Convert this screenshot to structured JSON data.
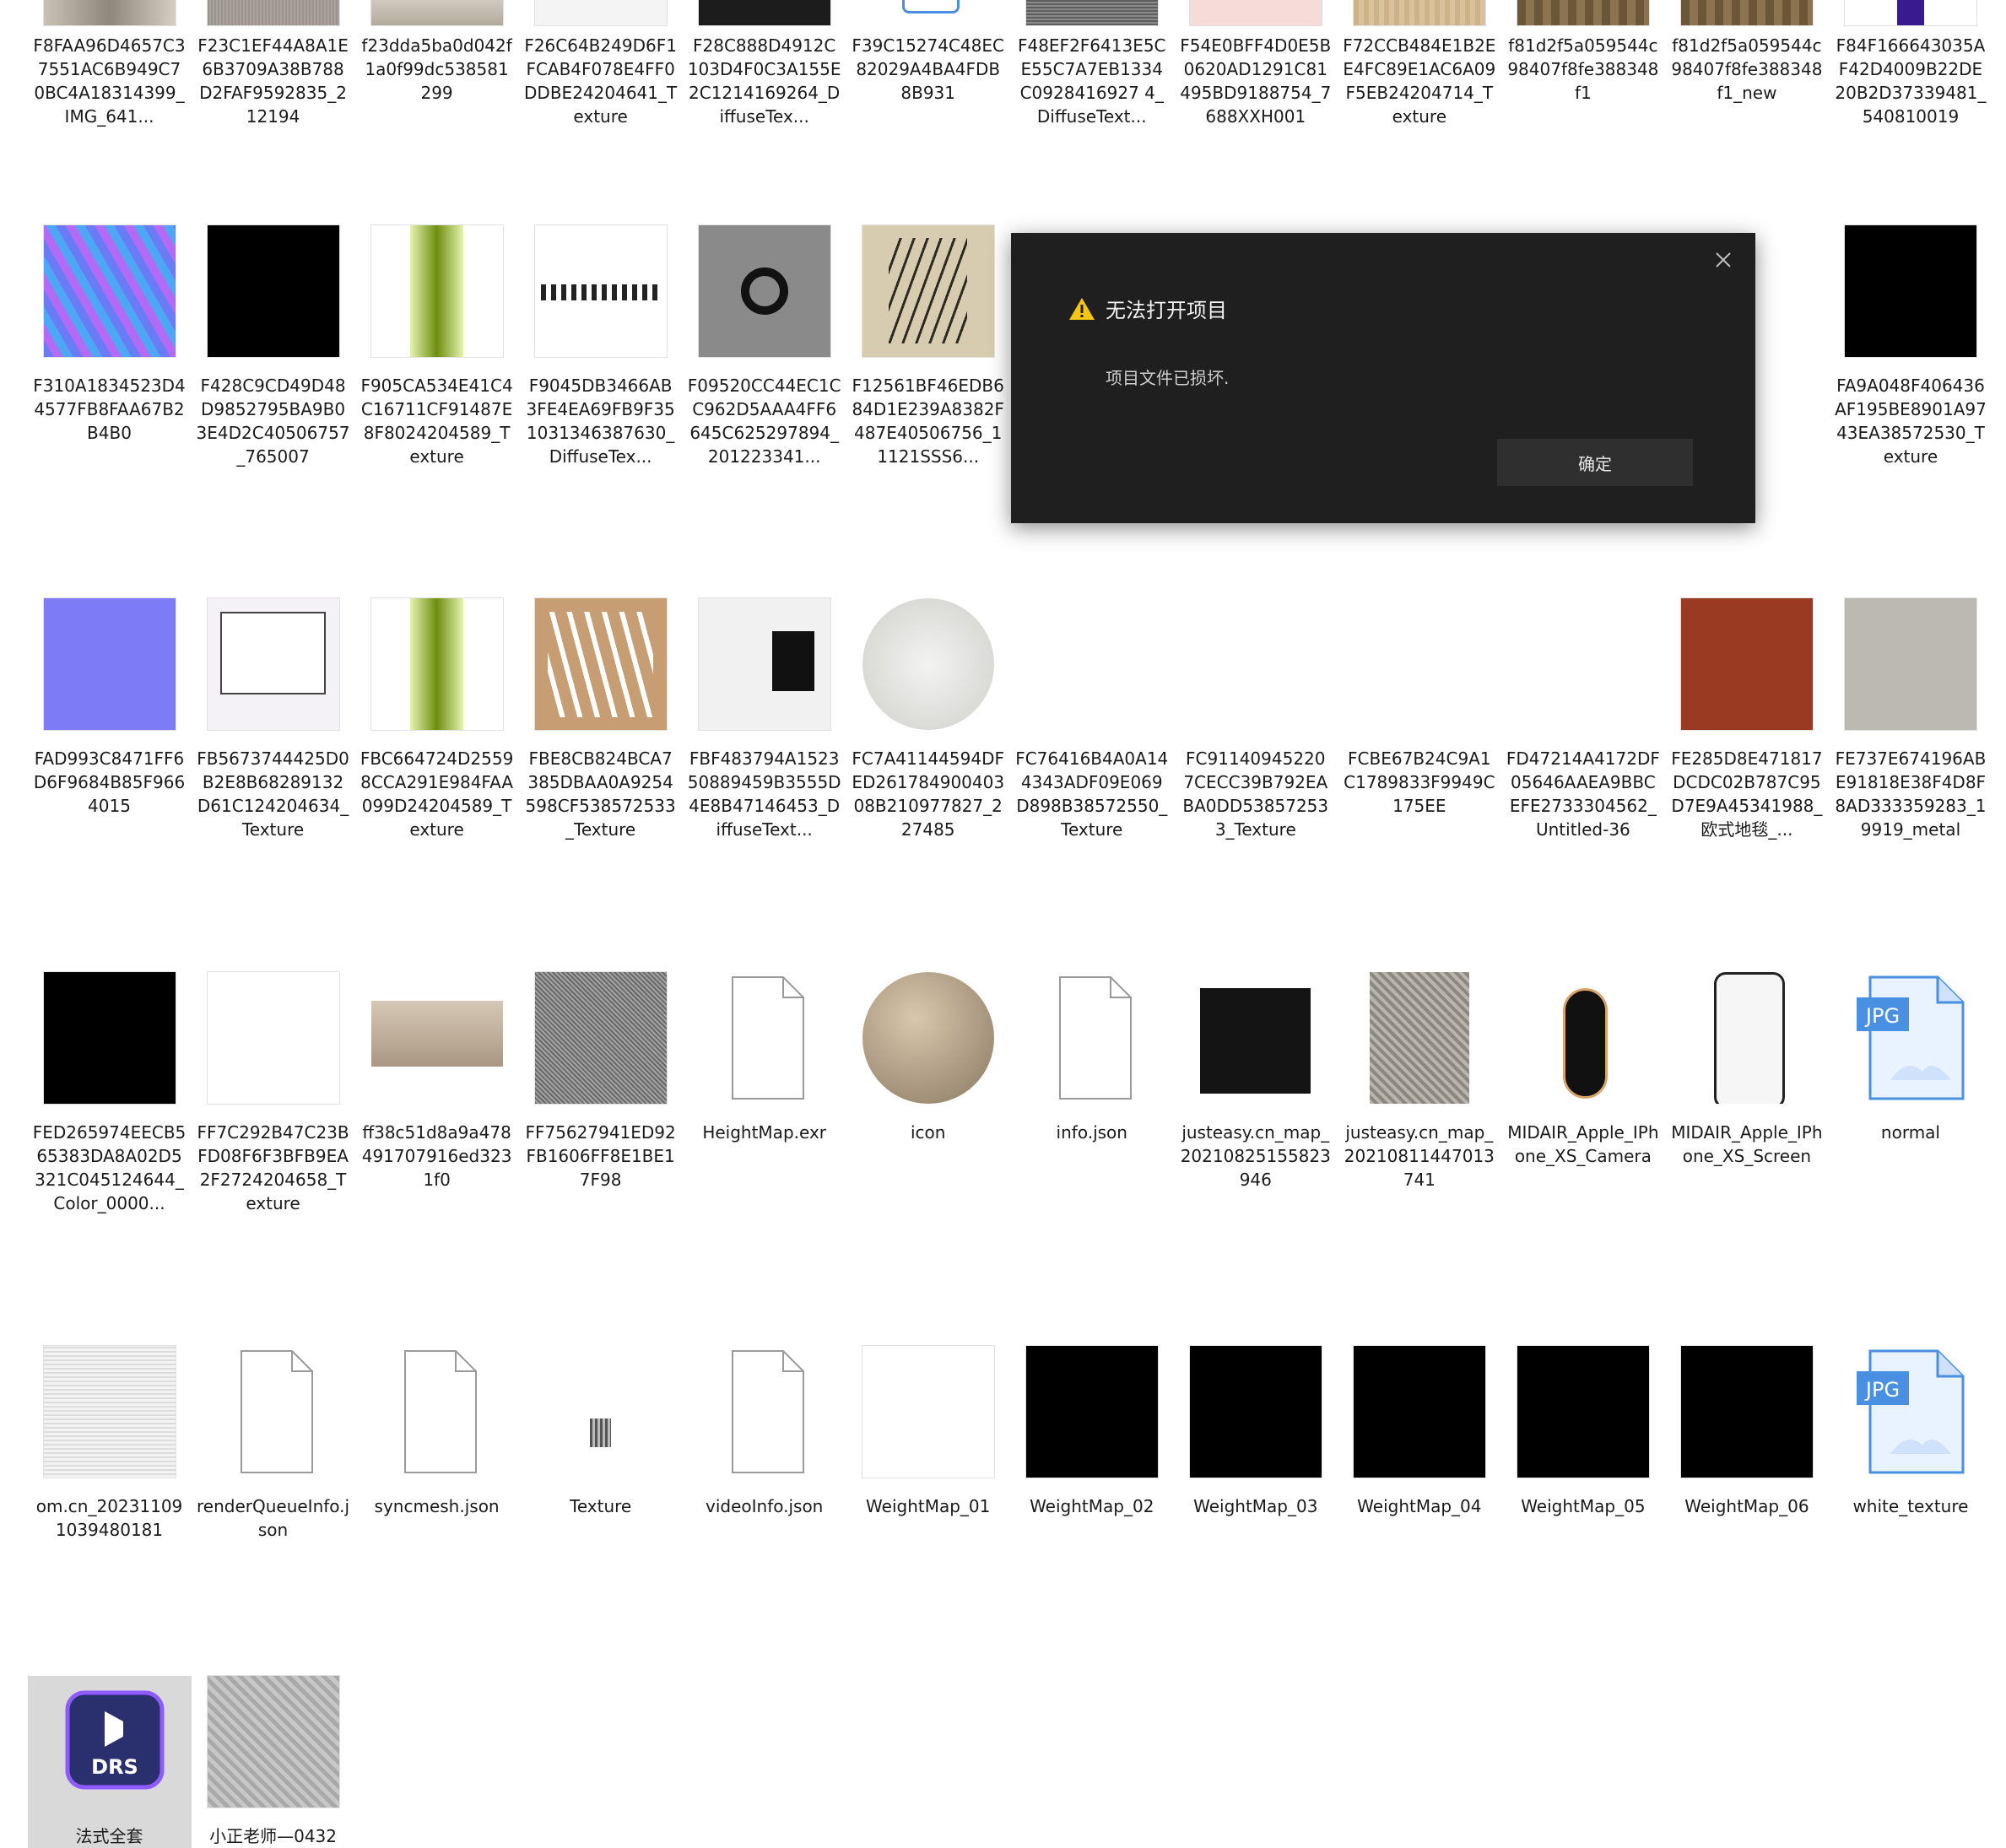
{
  "files": [
    {
      "label": "F8FAA96D4657C37551AC6B949C70BC4A18314399_IMG_641...",
      "thumb": "interior-photo"
    },
    {
      "label": "F23C1EF44A8A1E6B3709A38B788D2FAF9592835_212194",
      "thumb": "gray-fabric"
    },
    {
      "label": "f23dda5ba0d042f1a0f99dc538581299",
      "thumb": "bedroom-photo"
    },
    {
      "label": "F26C64B249D6F1FCAB4F078E4FF0DDBE24204641_Texture",
      "thumb": "white-label"
    },
    {
      "label": "F28C888D4912C103D4F0C3A155E2C1214169264_DiffuseTex...",
      "thumb": "dark-texture"
    },
    {
      "label": "F39C15274C48EC82029A4BA4FDB8B931",
      "thumb": "file-icon-blue"
    },
    {
      "label": "F48EF2F6413E5CE55C7A7EB1334C0928416927 4_DiffuseText...",
      "thumb": "stripe-gray"
    },
    {
      "label": "F54E0BFF4D0E5B0620AD1291C81495BD9188754_7688XXH001",
      "thumb": "pink-flat"
    },
    {
      "label": "F72CCB484E1B2EE4FC89E1AC6A09F5EB24204714_Texture",
      "thumb": "wood-light"
    },
    {
      "label": "f81d2f5a059544c98407f8fe388348f1",
      "thumb": "curtain"
    },
    {
      "label": "f81d2f5a059544c98407f8fe388348f1_new",
      "thumb": "curtain"
    },
    {
      "label": "F84F166643035AF42D4009B22DE20B2D37339481_540810019",
      "thumb": "screen-purple"
    },
    {
      "label": "F310A1834523D44577FB8FAA67B2B4B0",
      "thumb": "wave-blue"
    },
    {
      "label": "F428C9CD49D48D9852795BA9B03E4D2C40506757_765007",
      "thumb": "black"
    },
    {
      "label": "F905CA534E41C4C16711CF91487E8F8024204589_Texture",
      "thumb": "green-stripe"
    },
    {
      "label": "F9045DB3466AB3FE4EA69FB9F351031346387630_DiffuseTex...",
      "thumb": "tonic-label"
    },
    {
      "label": "F09520CC44EC1CC962D5AAA4FF6645C625297894_201223341...",
      "thumb": "gray-ring"
    },
    {
      "label": "F12561BF46EDB684D1E239A8382F487E40506756_11121SSS6...",
      "thumb": "bamboo"
    },
    {
      "label": "FA9A048F406436AF195BE8901A9743EA38572530_Texture",
      "thumb": "black"
    },
    {
      "label": "FAD993C8471FF6D6F9684B85F9664015",
      "thumb": "normal-blue"
    },
    {
      "label": "FB5673744425D0B2E8B68289132D61C124204634_Texture",
      "thumb": "briochin"
    },
    {
      "label": "FBC664724D25598CCA291E984FAA099D24204589_Texture",
      "thumb": "green-stripe"
    },
    {
      "label": "FBE8CB824BCA7385DBAA0A9254598CF538572533_Texture",
      "thumb": "tan-pattern"
    },
    {
      "label": "FBF483794A152350889459B3555D4E8B47146453_DiffuseText...",
      "thumb": "appliance-panel"
    },
    {
      "label": "FC7A41144594DFED26178490040308B210977827_227485",
      "thumb": "white-disc"
    },
    {
      "label": "FC76416B4A0A144343ADF09E069D898B38572550_Texture",
      "thumb": "none"
    },
    {
      "label": "FC91140945220 7CECC39B792EABA0DD538572533_Texture",
      "thumb": "none"
    },
    {
      "label": "FCBE67B24C9A1C1789833F9949C175EE",
      "thumb": "none"
    },
    {
      "label": "FD47214A4172DF05646AAEA9BBCEFE2733304562_Untitled-36",
      "thumb": "none"
    },
    {
      "label": "FE285D8E471817DCDC02B787C95D7E9A45341988_欧式地毯_...",
      "thumb": "rug"
    },
    {
      "label": "FE737E674196ABE91818E38F4D8F8AD333359283_19919_metal",
      "thumb": "gray-flat"
    },
    {
      "label": "FED265974EECB565383DA8A02D5321C045124644_Color_0000...",
      "thumb": "black"
    },
    {
      "label": "FF7C292B47C23BFD08F6F3BFB9EA2F2724204658_Texture",
      "thumb": "white"
    },
    {
      "label": "ff38c51d8a9a478491707916ed3231f0",
      "thumb": "bed-photo"
    },
    {
      "label": "FF75627941ED92FB1606FF8E1BE17F98",
      "thumb": "gray-woven"
    },
    {
      "label": "HeightMap.exr",
      "thumb": "doc"
    },
    {
      "label": "icon",
      "thumb": "sphere"
    },
    {
      "label": "info.json",
      "thumb": "doc"
    },
    {
      "label": "justeasy.cn_map_20210825155823946",
      "thumb": "oven-panel"
    },
    {
      "label": "justeasy.cn_map_20210811447013741",
      "thumb": "rug-gray"
    },
    {
      "label": "MIDAIR_Apple_IPhone_XS_Camera",
      "thumb": "phone-camera"
    },
    {
      "label": "MIDAIR_Apple_IPhone_XS_Screen",
      "thumb": "phone-screen"
    },
    {
      "label": "normal",
      "thumb": "jpg"
    },
    {
      "label": "om.cn_202311091039480181",
      "thumb": "white-lines"
    },
    {
      "label": "renderQueueInfo.json",
      "thumb": "doc"
    },
    {
      "label": "syncmesh.json",
      "thumb": "doc"
    },
    {
      "label": "Texture",
      "thumb": "small-bars"
    },
    {
      "label": "videoInfo.json",
      "thumb": "doc"
    },
    {
      "label": "WeightMap_01",
      "thumb": "white"
    },
    {
      "label": "WeightMap_02",
      "thumb": "black"
    },
    {
      "label": "WeightMap_03",
      "thumb": "black"
    },
    {
      "label": "WeightMap_04",
      "thumb": "black"
    },
    {
      "label": "WeightMap_05",
      "thumb": "black"
    },
    {
      "label": "WeightMap_06",
      "thumb": "black"
    },
    {
      "label": "white_texture",
      "thumb": "jpg"
    },
    {
      "label": "法式全套",
      "thumb": "drs-app"
    },
    {
      "label": "小正老师—0432",
      "thumb": "gray-relief"
    }
  ],
  "dialog": {
    "title": "无法打开项目",
    "message": "项目文件已损坏.",
    "ok_label": "确定",
    "warning_color": "#f5c518"
  },
  "icons": {
    "jpg_badge": "JPG",
    "drs_badge": "DRS"
  },
  "colors": {
    "dialog_bg": "#1f1f1f",
    "button_bg": "#2f2f2f",
    "selected_bg": "#d9d9d9",
    "jpg_blue": "#4a90e2"
  }
}
